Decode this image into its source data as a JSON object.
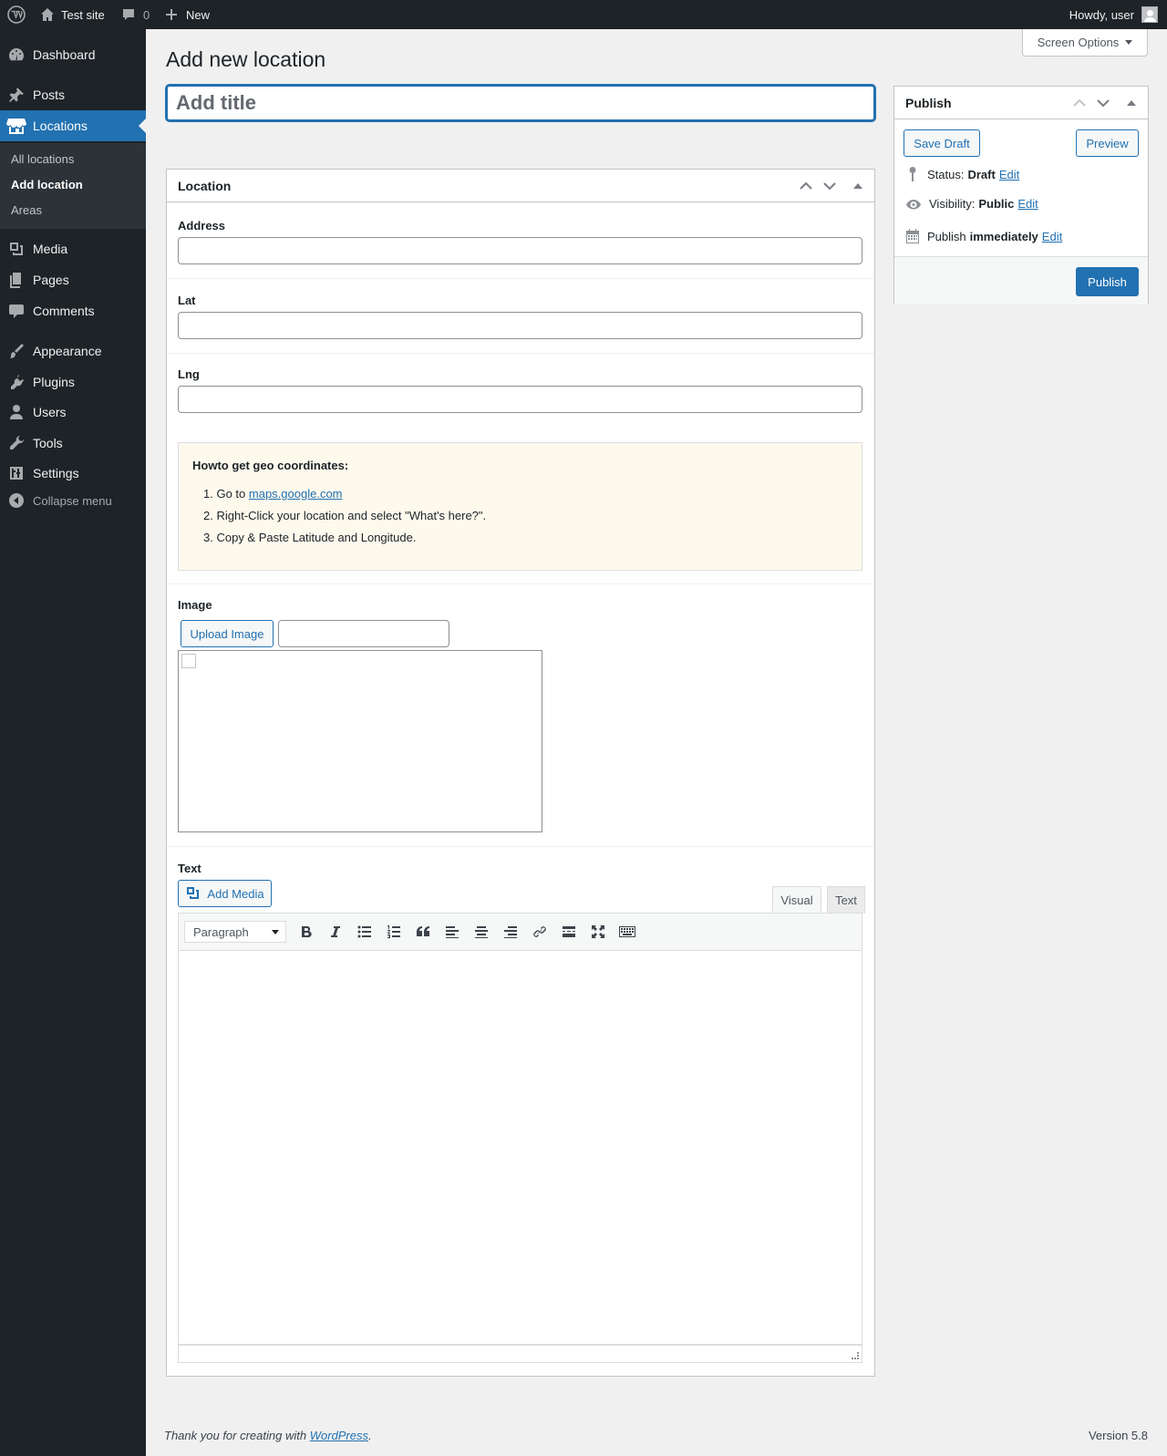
{
  "adminbar": {
    "site_name": "Test site",
    "comments_count": "0",
    "new_label": "New",
    "howdy": "Howdy, user"
  },
  "sidebar": {
    "items": [
      {
        "label": "Dashboard",
        "icon": "dashboard-icon"
      },
      {
        "label": "Posts",
        "icon": "pin-icon"
      },
      {
        "label": "Locations",
        "icon": "store-icon"
      },
      {
        "label": "Media",
        "icon": "media-icon"
      },
      {
        "label": "Pages",
        "icon": "pages-icon"
      },
      {
        "label": "Comments",
        "icon": "comment-icon"
      },
      {
        "label": "Appearance",
        "icon": "brush-icon"
      },
      {
        "label": "Plugins",
        "icon": "plugin-icon"
      },
      {
        "label": "Users",
        "icon": "users-icon"
      },
      {
        "label": "Tools",
        "icon": "wrench-icon"
      },
      {
        "label": "Settings",
        "icon": "settings-icon"
      }
    ],
    "submenu": [
      "All locations",
      "Add location",
      "Areas"
    ],
    "collapse_label": "Collapse menu"
  },
  "screen_options": "Screen Options",
  "page_title": "Add new location",
  "title_placeholder": "Add title",
  "location_box": {
    "title": "Location",
    "address_label": "Address",
    "lat_label": "Lat",
    "lng_label": "Lng",
    "howto_title": "Howto get geo coordinates:",
    "howto_steps": [
      {
        "num": "1.",
        "pre": "Go to ",
        "link": "maps.google.com"
      },
      {
        "num": "2.",
        "text": "Right-Click your location and select \"What's here?\"."
      },
      {
        "num": "3.",
        "text": "Copy & Paste Latitude and Longitude."
      }
    ],
    "image_label": "Image",
    "upload_label": "Upload Image",
    "text_label": "Text",
    "add_media_label": "Add Media",
    "tab_visual": "Visual",
    "tab_text": "Text",
    "format_select": "Paragraph"
  },
  "publish_box": {
    "title": "Publish",
    "save_draft": "Save Draft",
    "preview": "Preview",
    "status_label": "Status:",
    "status_value": "Draft",
    "visibility_label": "Visibility:",
    "visibility_value": "Public",
    "publish_label": "Publish",
    "publish_value": "immediately",
    "edit": "Edit",
    "publish_button": "Publish"
  },
  "footer": {
    "thanks_pre": "Thank you for creating with ",
    "thanks_link": "WordPress",
    "thanks_post": ".",
    "version": "Version 5.8"
  },
  "colors": {
    "accent": "#2271b1",
    "sidebar": "#1d2327",
    "notice_bg": "#fdf9ed"
  }
}
